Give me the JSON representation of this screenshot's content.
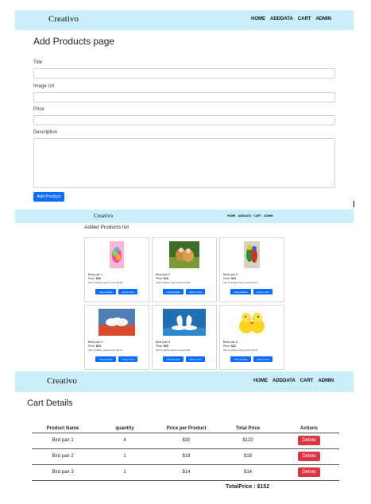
{
  "nav1": {
    "brand": "Creativo",
    "links": [
      "HOME",
      "ADDDATA",
      "CART",
      "ADMIN"
    ]
  },
  "form": {
    "heading": "Add Products page",
    "title_label": "Title",
    "image_label": "Image Url",
    "price_label": "Price",
    "description_label": "Description",
    "submit_label": "Add Product"
  },
  "nav2": {
    "brand": "Creativo",
    "links": [
      "HOME",
      "ADDDATA",
      "CART",
      "ADMIN"
    ]
  },
  "products": {
    "heading": "Added Products list",
    "items": [
      {
        "title": "Bird pair 1",
        "price_label": "Price:",
        "price": "$30",
        "desc": "that is selling nearly around $ 30",
        "view": "View Details",
        "add": "Add to Cart"
      },
      {
        "title": "Bird pair 2",
        "price_label": "Price:",
        "price": "$18",
        "desc": "that is selling nearly around $ 18",
        "view": "View Details",
        "add": "Add to Cart"
      },
      {
        "title": "Bird pair 3",
        "price_label": "Price:",
        "price": "$14",
        "desc": "that is selling nearly around $ 14",
        "view": "View Details",
        "add": "Add to Cart"
      },
      {
        "title": "Bird pair 4",
        "price_label": "Price:",
        "price": "$14",
        "desc": "that is selling nearly around $ 14",
        "view": "View Details",
        "add": "Add to Cart"
      },
      {
        "title": "Bird pair 5",
        "price_label": "Price:",
        "price": "$20",
        "desc": "that is selling nearly around $ 20",
        "view": "View Details",
        "add": "Add to Cart"
      },
      {
        "title": "Bird pair 6",
        "price_label": "Price:",
        "price": "$22",
        "desc": "that is selling nearly around $ 22",
        "view": "View Details",
        "add": "Add to Cart"
      }
    ]
  },
  "nav3": {
    "brand": "Creativo",
    "links": [
      "HOME",
      "ADDDATA",
      "CART",
      "ADMIN"
    ]
  },
  "cart": {
    "heading": "Cart Details",
    "columns": [
      "Product Name",
      "quantity",
      "Price per Product",
      "Total Price",
      "Actions"
    ],
    "rows": [
      {
        "name": "Bird pair 1",
        "qty": "4",
        "price": "$30",
        "total": "$120",
        "action": "Delete"
      },
      {
        "name": "Bird pair 2",
        "qty": "1",
        "price": "$18",
        "total": "$18",
        "action": "Delete"
      },
      {
        "name": "Bird pair 3",
        "qty": "1",
        "price": "$14",
        "total": "$14",
        "action": "Delete"
      }
    ],
    "total_text": "TotalPrice : $152"
  },
  "colors": {
    "navbar": "#cbeffa",
    "primary": "#0d6efd",
    "danger": "#dc3545"
  }
}
